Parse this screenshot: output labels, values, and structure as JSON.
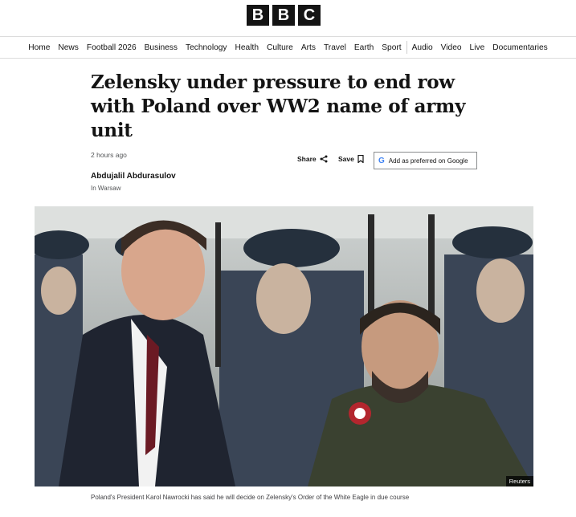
{
  "brand": {
    "logo_letters": [
      "B",
      "B",
      "C"
    ]
  },
  "nav": {
    "items": [
      "Home",
      "News",
      "Football 2026",
      "Business",
      "Technology",
      "Health",
      "Culture",
      "Arts",
      "Travel",
      "Earth",
      "Sport",
      "Audio",
      "Video",
      "Live",
      "Documentaries"
    ]
  },
  "article": {
    "headline": "Zelensky under pressure to end row with Poland over WW2 name of army unit",
    "timestamp": "2 hours ago",
    "author": "Abdujalil Abdurasulov",
    "location": "In Warsaw",
    "share_label": "Share",
    "save_label": "Save",
    "google_label": "Add as preferred on Google",
    "photo_credit": "Reuters",
    "caption": "Poland's President Karol Nawrocki has said he will decide on Zelensky's Order of the White Eagle in due course"
  },
  "icons": {
    "share": "share-icon",
    "save": "bookmark-icon",
    "google": "google-icon"
  }
}
